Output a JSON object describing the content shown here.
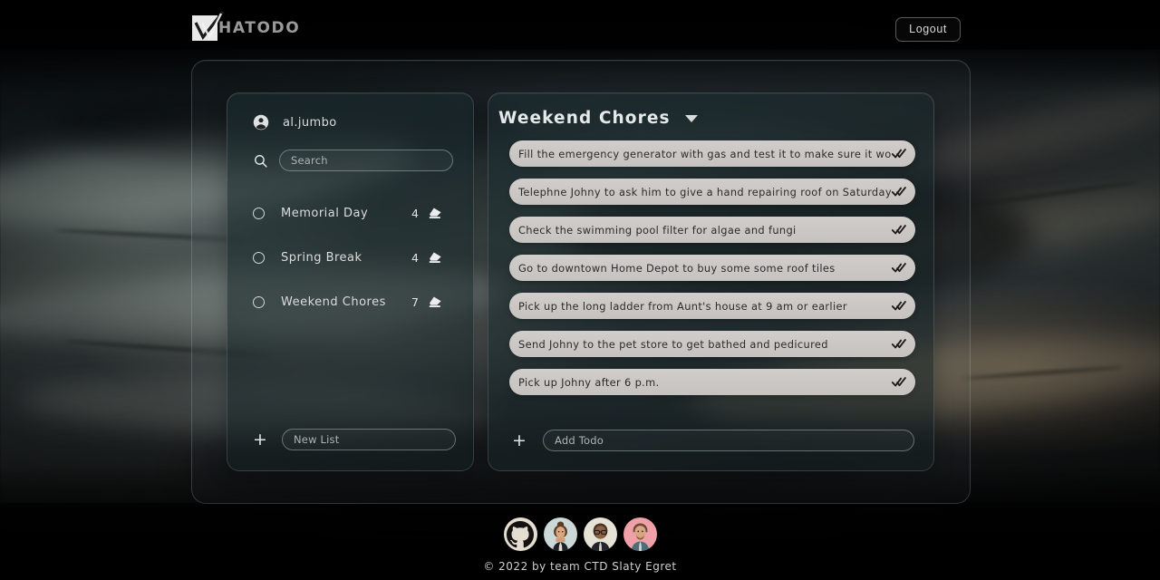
{
  "header": {
    "logo_icon": "checkbox-check-logo-icon",
    "brand": "HATODO",
    "logout_label": "Logout"
  },
  "sidebar": {
    "user_icon": "account-circle-icon",
    "username": "al.jumbo",
    "search_icon": "search-icon",
    "search": {
      "value": "",
      "placeholder": "Search"
    },
    "lists": [
      {
        "name": "Memorial Day",
        "count": "4",
        "bullet_icon": "circle-icon",
        "delete_icon": "eraser-icon"
      },
      {
        "name": "Spring Break",
        "count": "4",
        "bullet_icon": "circle-icon",
        "delete_icon": "eraser-icon"
      },
      {
        "name": "Weekend Chores",
        "count": "7",
        "bullet_icon": "circle-icon",
        "delete_icon": "eraser-icon"
      }
    ],
    "add_list": {
      "plus_icon": "plus-icon",
      "plus_label": "+",
      "input": {
        "value": "",
        "placeholder": "New List"
      }
    }
  },
  "main": {
    "title": "Weekend Chores",
    "dropdown_icon": "caret-down-icon",
    "todos": [
      {
        "text": "Fill the emergency generator with gas and test it to make sure it works",
        "done_icon": "done-all-icon"
      },
      {
        "text": "Telephne Johny to ask him to give a hand repairing roof on Saturday",
        "done_icon": "done-all-icon"
      },
      {
        "text": "Check the swimming pool filter for algae and fungi",
        "done_icon": "done-all-icon"
      },
      {
        "text": "Go to downtown Home Depot to buy some some roof tiles",
        "done_icon": "done-all-icon"
      },
      {
        "text": "Pick up the long ladder from Aunt's house at 9 am or earlier",
        "done_icon": "done-all-icon"
      },
      {
        "text": "Send Johny to the pet store to get bathed and pedicured",
        "done_icon": "done-all-icon"
      },
      {
        "text": "Pick up Johny after 6 p.m.",
        "done_icon": "done-all-icon"
      }
    ],
    "add_todo": {
      "plus_icon": "plus-icon",
      "plus_label": "+",
      "input": {
        "value": "",
        "placeholder": "Add Todo"
      }
    }
  },
  "footer": {
    "github_icon": "github-icon",
    "avatars": [
      "team-avatar-1",
      "team-avatar-2",
      "team-avatar-3"
    ],
    "copyright": "© 2022 by team CTD Slaty Egret"
  },
  "colors": {
    "todo_pill": "#c9c5c2",
    "panel_border": "#b9cdd2",
    "text_light": "#dcdcdc",
    "text_dark": "#2b2b2b",
    "logo_box": "#e9e9e9"
  }
}
